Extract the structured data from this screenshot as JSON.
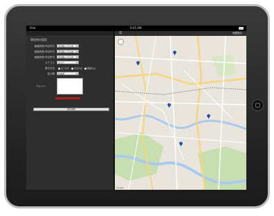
{
  "device": {
    "status_bar": {
      "carrier": "iPad",
      "clock": "9:45 AM"
    }
  },
  "form": {
    "heading": "現在地の設定",
    "rows": [
      {
        "label": "都道府県/市区町村",
        "value": "東京都/八王子市"
      },
      {
        "label": "都道府県/市区町村",
        "value": "東京都/八王子市"
      },
      {
        "label": "都道府県/市区町村",
        "value": "東京都/八王子市"
      },
      {
        "label": "カテゴリ",
        "value": "すべて"
      }
    ],
    "radio": {
      "label": "表示方法",
      "options": [
        "全て表示",
        "直近のみ",
        "履歴のみ"
      ]
    },
    "sort": {
      "label": "並び順",
      "value": "新着順"
    },
    "comment_label": "コメント",
    "submit_label": "検索開始"
  },
  "map": {
    "menu_icon": "hamburger-icon",
    "title": "地図表示",
    "pins_icon": "map-pin-icon",
    "footer": "Google",
    "colors": {
      "land": "#e9e5dc",
      "park": "#c7dfb0",
      "water": "#a9c9ef",
      "road": "#ffffff",
      "highway": "#f6d57b",
      "pin": "#1f4fa8"
    }
  }
}
